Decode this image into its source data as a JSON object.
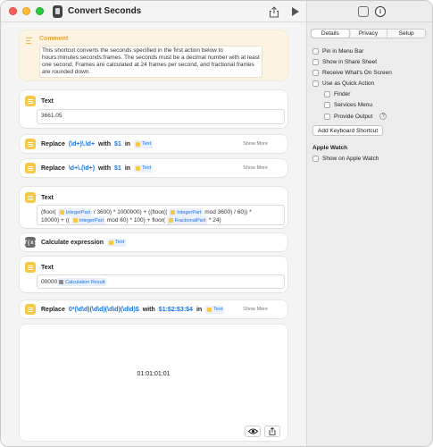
{
  "window": {
    "title": "Convert Seconds"
  },
  "comment": {
    "title": "Comment",
    "text": "This shortcut converts the seconds specified in the first action below to hours:minutes:seconds:frames. The seconds must be a decimal number with at least one second. Frames are calculated at 24 frames per second, and fractional frames are rounded down."
  },
  "actions": {
    "text1": {
      "label": "Text",
      "value": "3661.05"
    },
    "replace1": {
      "label": "Replace",
      "pattern": "(\\d+)\\.\\d+",
      "with": "with",
      "replacement": "$1",
      "in": "in",
      "var": "Text",
      "show_more": "Show More"
    },
    "replace2": {
      "label": "Replace",
      "pattern": "\\d+\\.(\\d+)",
      "with": "with",
      "replacement": "$1",
      "in": "in",
      "var": "Text",
      "show_more": "Show More"
    },
    "text2": {
      "label": "Text",
      "p1": "(floor(",
      "v_int1": "IntegerPart",
      "p2": "/ 3600) * 1000000) + ((floor((",
      "v_int2": "IntegerPart",
      "p3": "mod 3600) / 60)) *",
      "p4": "10000) + ((",
      "v_int3": "IntegerPart",
      "p5": "mod 60) * 100) + floor(",
      "v_frac": "FractionalPart",
      "p6": "* 24)"
    },
    "calc": {
      "label": "Calculate expression",
      "var": "Text"
    },
    "text3": {
      "label": "Text",
      "prefix": "00000",
      "var": "Calculation Result"
    },
    "replace3": {
      "label": "Replace",
      "pattern": "0*(\\d\\d)(\\d\\d)(\\d\\d)(\\d\\d)$",
      "with": "with",
      "replacement": "$1:$2:$3:$4",
      "in": "in",
      "var": "Text",
      "show_more": "Show More"
    }
  },
  "result": {
    "value": "01:01:01:01"
  },
  "panel": {
    "tabs": [
      "Details",
      "Privacy",
      "Setup"
    ],
    "options": {
      "pin_menu_bar": "Pin in Menu Bar",
      "share_sheet": "Show in Share Sheet",
      "receive_onscreen": "Receive What's On Screen",
      "quick_action": "Use as Quick Action",
      "finder": "Finder",
      "services_menu": "Services Menu",
      "provide_output": "Provide Output"
    },
    "help": "?",
    "keyboard_shortcut": "Add Keyboard Shortcut",
    "apple_watch_heading": "Apple Watch",
    "show_on_watch": "Show on Apple Watch"
  }
}
